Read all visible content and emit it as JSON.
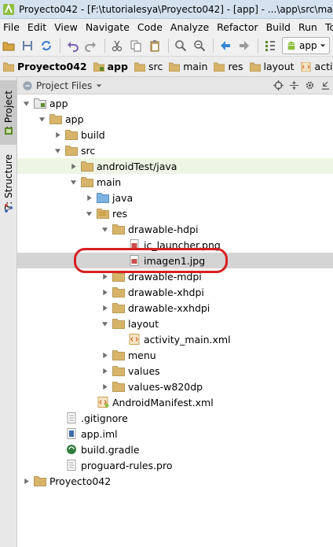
{
  "window": {
    "title": "Proyecto042 - [F:\\tutorialesya\\Proyecto042] - [app] - ...\\app\\src\\main\\res\\layout\\activity_main.xml"
  },
  "menu": [
    "File",
    "Edit",
    "View",
    "Navigate",
    "Code",
    "Analyze",
    "Refactor",
    "Build",
    "Run",
    "Tools"
  ],
  "toolbar": {
    "run_config": "app"
  },
  "breadcrumb": [
    "Proyecto042",
    "app",
    "src",
    "main",
    "res",
    "layout",
    "activity_main.xml"
  ],
  "side_tabs": {
    "project": "1: Project",
    "structure": "7: Structure"
  },
  "panel": {
    "view_mode": "Project Files"
  },
  "tree": [
    {
      "label": "app",
      "icon": "module-folder-icon",
      "expand": "open"
    },
    {
      "label": "app",
      "icon": "folder-icon",
      "expand": "open"
    },
    {
      "label": "build",
      "icon": "folder-icon",
      "expand": "closed"
    },
    {
      "label": "src",
      "icon": "folder-icon",
      "expand": "open"
    },
    {
      "label": "androidTest/java",
      "icon": "folder-icon",
      "expand": "closed"
    },
    {
      "label": "main",
      "icon": "folder-icon",
      "expand": "open"
    },
    {
      "label": "java",
      "icon": "source-folder-icon",
      "expand": "closed"
    },
    {
      "label": "res",
      "icon": "resource-folder-icon",
      "expand": "open"
    },
    {
      "label": "drawable-hdpi",
      "icon": "folder-icon",
      "expand": "open"
    },
    {
      "label": "ic_launcher.png",
      "icon": "image-file-icon",
      "expand": "none"
    },
    {
      "label": "imagen1.jpg",
      "icon": "image-file-icon",
      "expand": "none"
    },
    {
      "label": "drawable-mdpi",
      "icon": "folder-icon",
      "expand": "closed"
    },
    {
      "label": "drawable-xhdpi",
      "icon": "folder-icon",
      "expand": "closed"
    },
    {
      "label": "drawable-xxhdpi",
      "icon": "folder-icon",
      "expand": "closed"
    },
    {
      "label": "layout",
      "icon": "folder-icon",
      "expand": "open"
    },
    {
      "label": "activity_main.xml",
      "icon": "xml-layout-icon",
      "expand": "none"
    },
    {
      "label": "menu",
      "icon": "folder-icon",
      "expand": "closed"
    },
    {
      "label": "values",
      "icon": "folder-icon",
      "expand": "closed"
    },
    {
      "label": "values-w820dp",
      "icon": "folder-icon",
      "expand": "closed"
    },
    {
      "label": "AndroidManifest.xml",
      "icon": "xml-manifest-icon",
      "expand": "none"
    },
    {
      "label": ".gitignore",
      "icon": "text-file-icon",
      "expand": "none"
    },
    {
      "label": "app.iml",
      "icon": "iml-file-icon",
      "expand": "none"
    },
    {
      "label": "build.gradle",
      "icon": "gradle-file-icon",
      "expand": "none"
    },
    {
      "label": "proguard-rules.pro",
      "icon": "text-file-icon",
      "expand": "none"
    },
    {
      "label": "Proyecto042",
      "icon": "folder-icon",
      "expand": "closed"
    }
  ],
  "colors": {
    "highlight_ring": "#d62020",
    "selected_row": "#d4d4d4",
    "folder": "#d7b46a"
  }
}
